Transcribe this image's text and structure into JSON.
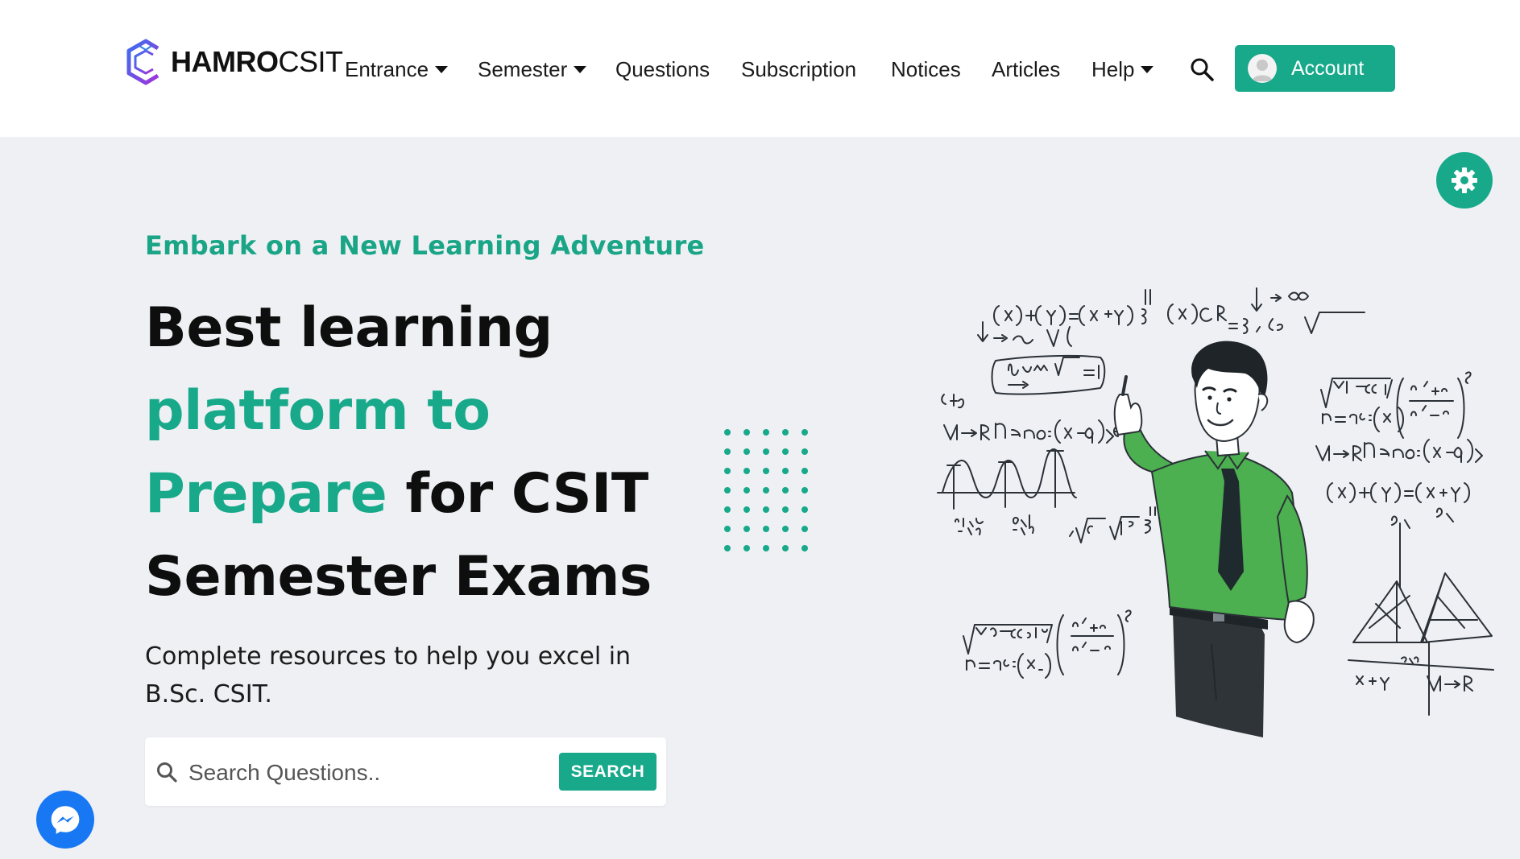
{
  "header": {
    "logo": {
      "bold": "HAMRO",
      "light": "CSIT",
      "icon": "hexagon-logo-icon"
    },
    "nav": [
      {
        "label": "Entrance",
        "dropdown": true
      },
      {
        "label": "Semester",
        "dropdown": true
      },
      {
        "label": "Questions",
        "dropdown": false
      },
      {
        "label": "Subscription",
        "dropdown": false
      },
      {
        "label": "Notices",
        "dropdown": false
      },
      {
        "label": "Articles",
        "dropdown": false
      },
      {
        "label": "Help",
        "dropdown": true
      }
    ],
    "search_icon": "search-icon",
    "account_label": "Account",
    "accent_color": "#17a98a"
  },
  "hero": {
    "tagline": "Embark on a New Learning Adventure",
    "headline": {
      "line1": "Best learning",
      "line2_accent": "platform to",
      "line3_accent": "Prepare",
      "line3_rest": " for CSIT",
      "line4": "Semester Exams"
    },
    "subtitle": "Complete resources to help you excel in B.Sc. CSIT.",
    "search": {
      "placeholder": "Search Questions..",
      "value": "",
      "button_label": "SEARCH"
    },
    "illustration": "teacher-with-math-formulas-illustration"
  },
  "floating": {
    "settings_icon": "gear-icon",
    "chat_icon": "messenger-icon"
  }
}
